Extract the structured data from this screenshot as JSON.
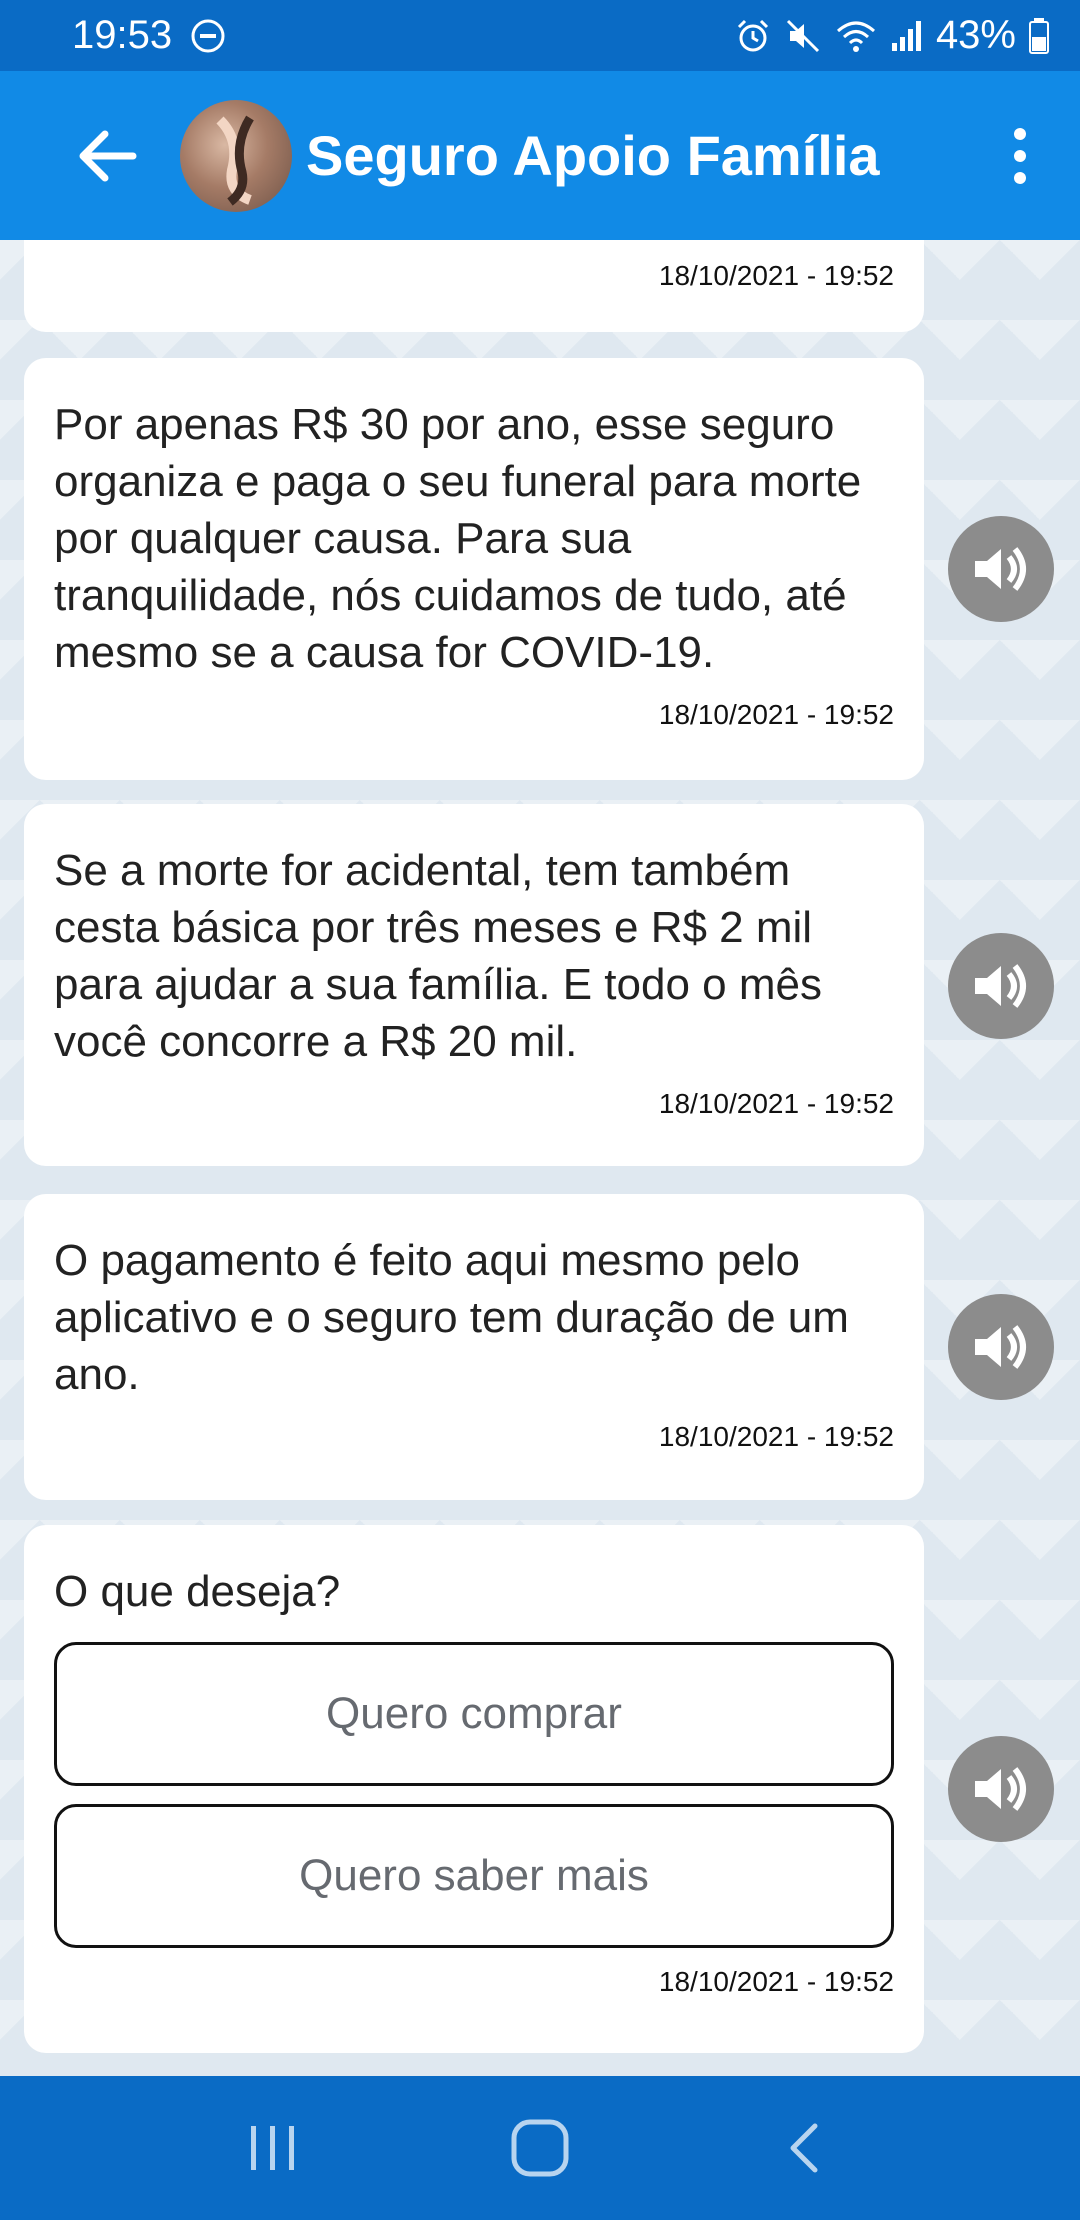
{
  "status_bar": {
    "time": "19:53",
    "battery": "43%"
  },
  "app_bar": {
    "title": "Seguro Apoio Família"
  },
  "messages": [
    {
      "text": "",
      "time": "18/10/2021 - 19:52"
    },
    {
      "text": "Por apenas R$ 30 por ano, esse seguro organiza e paga o seu funeral para morte por qualquer causa. Para sua tranquilidade, nós cuidamos de tudo, até mesmo se a causa for COVID-19.",
      "time": "18/10/2021 - 19:52"
    },
    {
      "text": "Se a morte for acidental, tem também cesta básica por três meses e R$ 2 mil para ajudar a sua família. E todo o mês você concorre a R$ 20 mil.",
      "time": "18/10/2021 - 19:52"
    },
    {
      "text": "O pagamento é feito aqui mesmo pelo aplicativo e o seguro tem duração de um ano.",
      "time": "18/10/2021 - 19:52"
    },
    {
      "text": "O que deseja?",
      "time": "18/10/2021 - 19:52"
    }
  ],
  "options": {
    "buy": "Quero comprar",
    "learn_more": "Quero saber mais"
  },
  "colors": {
    "status_bar": "#0a6bc5",
    "app_bar": "#118ae6",
    "audio_button": "#8c8c8c"
  },
  "icons": {
    "back": "arrow-left-icon",
    "menu": "more-vertical-icon",
    "audio": "speaker-icon",
    "nav_recents": "recents-icon",
    "nav_home": "home-icon",
    "nav_back": "chevron-left-icon"
  }
}
